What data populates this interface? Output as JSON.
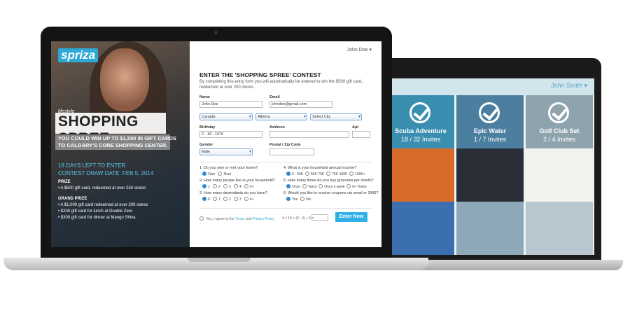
{
  "back_screen": {
    "user_name": "John Smith ▾",
    "tiles": [
      {
        "title": "Scuba Adventure",
        "invites": "18 / 32 Invites",
        "color": "#3a8fb0",
        "checked": true
      },
      {
        "title": "Epic Water",
        "invites": "1 / 7 Invites",
        "color": "#4c7ea0",
        "checked": true
      },
      {
        "title": "Golf Club Set",
        "invites": "2 / 4 Invites",
        "color": "#8ea3ad",
        "checked": true
      },
      {
        "title": "",
        "invites": "",
        "color": "#d86a2a",
        "checked": false
      },
      {
        "title": "",
        "invites": "",
        "color": "#2a2f37",
        "checked": false
      },
      {
        "title": "",
        "invites": "",
        "color": "#f3f1ec",
        "checked": false
      },
      {
        "title": "",
        "invites": "",
        "color": "#3b6fb0",
        "checked": false
      },
      {
        "title": "",
        "invites": "",
        "color": "#8da9b9",
        "checked": false
      },
      {
        "title": "",
        "invites": "",
        "color": "#b8c7cf",
        "checked": false
      }
    ]
  },
  "promo": {
    "logo": "spriza",
    "lifestyle": "lifestyle",
    "title": "SHOPPING SPREE",
    "subtitle": "YOU COULD WIN UP TO $1,500 IN GIFT CARDS TO CALGARY'S CORE SHOPPING CENTER.",
    "days_left": "18 DAYS LEFT TO ENTER",
    "draw_date": "CONTEST DRAW DATE: FEB 5, 2014",
    "prize_heading": "PRIZE",
    "prize_items": [
      "• A $500 gift card, redeemed at over 250 stores"
    ],
    "grand_heading": "GRAND PRIZE",
    "grand_items": [
      "• A $1,000 gift card redeemed at over 200 stores",
      "• $200 gift card for lunch at Double Zero",
      "• $300 gift card for dinner at Mango Shiva"
    ]
  },
  "form": {
    "user_name": "John Doe ▾",
    "title": "ENTER THE 'SHOPPING SPREE' CONTEST",
    "description": "By completing this entry form you will automatically be entered to win the $500 gift card, redeemed at over 200 stores.",
    "name_label": "Name",
    "name_value": "John Doe",
    "email_label": "Email",
    "email_value": "johndoe@gmail.com",
    "country": "Canada",
    "province": "Alberta",
    "city": "Select City",
    "birthday_label": "Birthday",
    "birthday_value": "2 - 18 - 1976",
    "address_label": "Address",
    "apt_label": "Apt",
    "gender_label": "Gender",
    "gender_value": "Male",
    "postal_label": "Postal / Zip Code",
    "q1": "1. Do you own or rent your home?",
    "q1_opts": [
      "Own",
      "Rent"
    ],
    "q2": "2. How many people live in your household?",
    "q2_opts": [
      "1",
      "2",
      "3",
      "4",
      "5+"
    ],
    "q3": "3. How many dependants do you have?",
    "q3_opts": [
      "0",
      "1",
      "2",
      "3",
      "4+"
    ],
    "q4": "4. What is your household annual income?",
    "q4_opts": [
      "0 - 50K",
      "50K-75K",
      "75K-100K",
      "100K+"
    ],
    "q5": "5. How many times do you buy groceries per month?",
    "q5_opts": [
      "Once",
      "Twice",
      "Once a week",
      "6+ Times"
    ],
    "q6": "6. Would you like to receive coupons via email or SMS?",
    "q6_opts": [
      "Yes",
      "No"
    ],
    "agree_prefix": "Yes, I agree to the",
    "terms": "Terms",
    "and": "and",
    "privacy": "Privacy Policy",
    "equation": "4 x 10 + (8 - 3) + 5 =",
    "enter_button": "Enter Now"
  }
}
